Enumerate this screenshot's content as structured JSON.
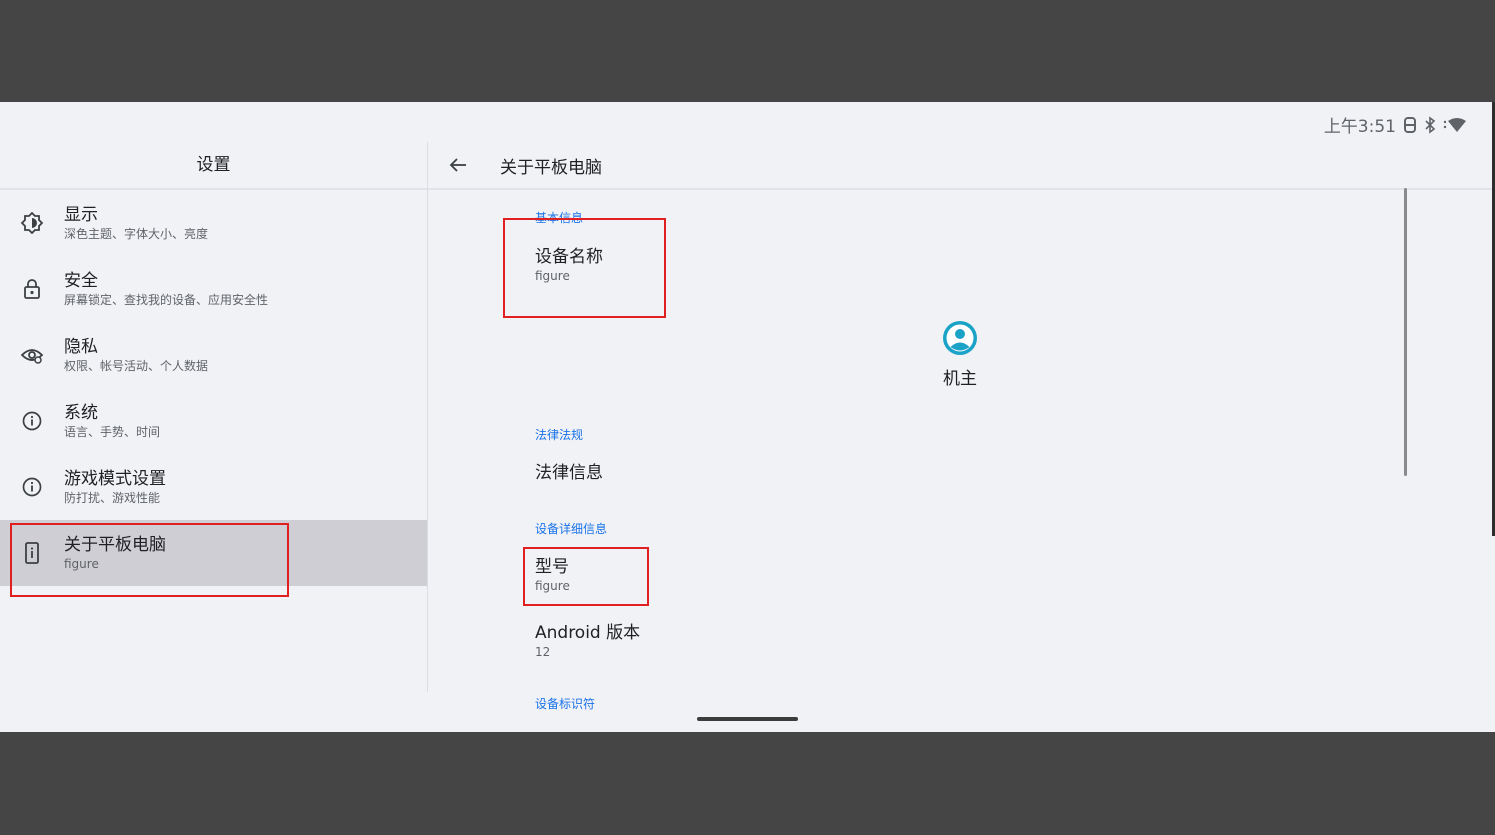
{
  "status": {
    "time": "上午3:51"
  },
  "left": {
    "title": "设置",
    "items": [
      {
        "title": "显示",
        "subtitle": "深色主题、字体大小、亮度",
        "icon": "display-icon"
      },
      {
        "title": "安全",
        "subtitle": "屏幕锁定、查找我的设备、应用安全性",
        "icon": "lock-icon"
      },
      {
        "title": "隐私",
        "subtitle": "权限、帐号活动、个人数据",
        "icon": "privacy-eye-icon"
      },
      {
        "title": "系统",
        "subtitle": "语言、手势、时间",
        "icon": "info-icon"
      },
      {
        "title": "游戏模式设置",
        "subtitle": "防打扰、游戏性能",
        "icon": "info-icon"
      },
      {
        "title": "关于平板电脑",
        "subtitle": "figure",
        "icon": "tablet-info-icon",
        "selected": true
      }
    ]
  },
  "right": {
    "title": "关于平板电脑",
    "sections": {
      "basic": "基本信息",
      "legal": "法律法规",
      "details": "设备详细信息",
      "identifiers": "设备标识符"
    },
    "device_name": {
      "title": "设备名称",
      "value": "figure"
    },
    "owner": "机主",
    "legal_info": "法律信息",
    "model": {
      "title": "型号",
      "value": "figure"
    },
    "android_version": {
      "title": "Android 版本",
      "value": "12"
    }
  },
  "colors": {
    "accent": "#1a73e8",
    "owner_icon": "#1aa3c7",
    "highlight": "#e02020",
    "selected_bg": "#cfced4"
  }
}
